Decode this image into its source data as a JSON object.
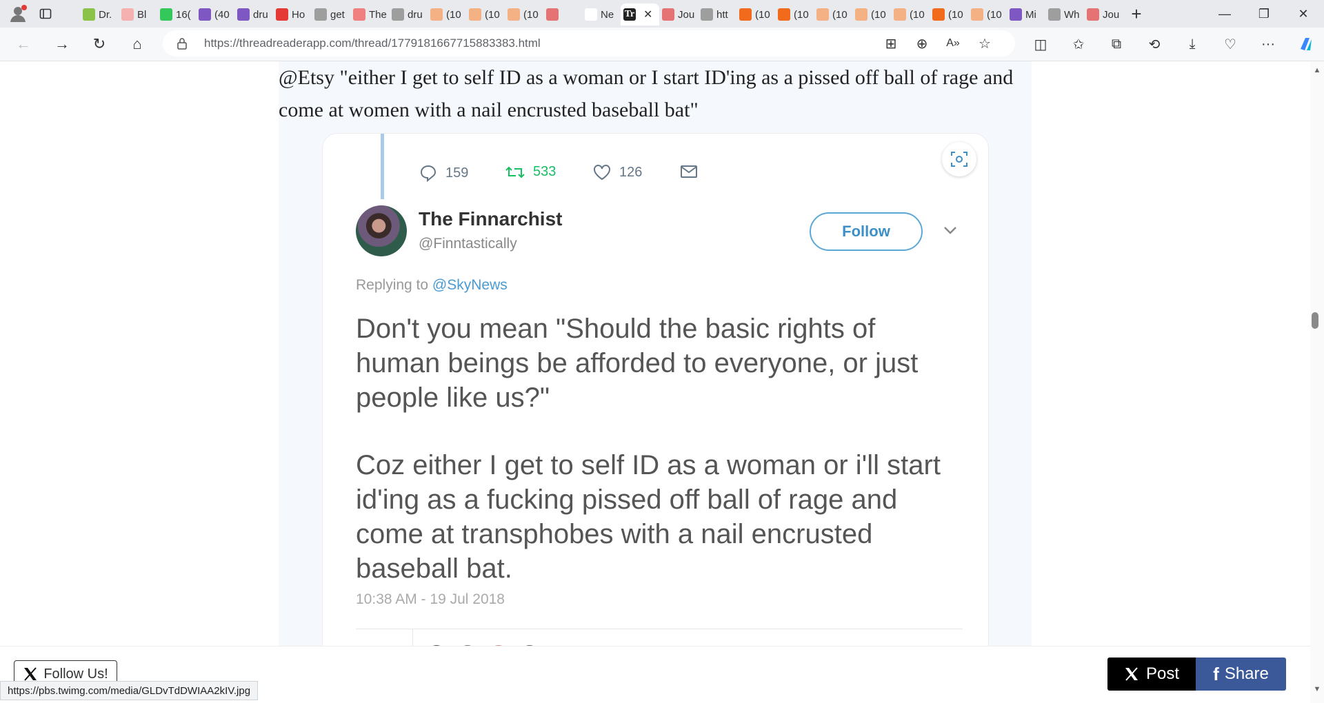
{
  "browser": {
    "tabs": [
      {
        "label": "Dr.",
        "icon": "play-icon",
        "color": "#8bc34a"
      },
      {
        "label": "Bl",
        "icon": "bi-icon",
        "color": "#f5b0b0"
      },
      {
        "label": "16(",
        "icon": "g-icon",
        "color": "#34c759"
      },
      {
        "label": "(40",
        "icon": "yahoo-icon",
        "color": "#7e57c2"
      },
      {
        "label": "dru",
        "icon": "yahoo-icon",
        "color": "#7e57c2"
      },
      {
        "label": "Ho",
        "icon": "pin-icon",
        "color": "#e53935"
      },
      {
        "label": "get",
        "icon": "search-icon",
        "color": "#9e9e9e"
      },
      {
        "label": "The",
        "icon": "ds-icon",
        "color": "#f08080"
      },
      {
        "label": "dru",
        "icon": "file-icon",
        "color": "#9e9e9e"
      },
      {
        "label": "(10",
        "icon": "bookmark-icon",
        "color": "#f4b183"
      },
      {
        "label": "(10",
        "icon": "bookmark-icon",
        "color": "#f4b183"
      },
      {
        "label": "(10",
        "icon": "bookmark-icon",
        "color": "#f4b183"
      },
      {
        "label": "",
        "icon": "r-icon",
        "color": "#e57373"
      },
      {
        "label": "Ne",
        "icon": "",
        "color": "#ffffff"
      }
    ],
    "active_tab": {
      "label": "Tr",
      "close": "✕"
    },
    "tabs_after": [
      {
        "label": "Jou",
        "icon": "youtube-icon",
        "color": "#e57373"
      },
      {
        "label": "htt",
        "icon": "file-icon",
        "color": "#9e9e9e"
      },
      {
        "label": "(10",
        "icon": "bookmark-icon",
        "color": "#f26b1d"
      },
      {
        "label": "(10",
        "icon": "bookmark-icon",
        "color": "#f26b1d"
      },
      {
        "label": "(10",
        "icon": "bookmark-icon",
        "color": "#f4b183"
      },
      {
        "label": "(10",
        "icon": "bookmark-icon",
        "color": "#f4b183"
      },
      {
        "label": "(10",
        "icon": "bookmark-icon",
        "color": "#f4b183"
      },
      {
        "label": "(10",
        "icon": "bookmark-icon",
        "color": "#f26b1d"
      },
      {
        "label": "(10",
        "icon": "bookmark-icon",
        "color": "#f4b183"
      },
      {
        "label": "Mi",
        "icon": "yahoo-icon",
        "color": "#7e57c2"
      },
      {
        "label": "Wh",
        "icon": "file-icon",
        "color": "#9e9e9e"
      },
      {
        "label": "Jou",
        "icon": "youtube-icon",
        "color": "#e57373"
      }
    ],
    "new_tab": "+",
    "url_domain": "https://threadreaderapp.com",
    "url_path": "/thread/1779181667715883383.html"
  },
  "thread": {
    "tweet_text": "@Etsy \"either I get to self ID as a woman or I start ID'ing as a pissed off ball of rage and come at women with a nail encrusted baseball bat\""
  },
  "embedded_tweet": {
    "replies": "159",
    "retweets": "533",
    "likes": "126",
    "name": "The Finnarchist",
    "handle": "@Finntastically",
    "follow_label": "Follow",
    "replying_prefix": "Replying to ",
    "replying_mention": "@SkyNews",
    "body_1": "Don't you mean \"Should the basic rights of human beings be afforded to everyone, or just people like us?\"",
    "body_2": "Coz either I get to self ID as a woman or i'll start id'ing as a fucking pissed off ball of rage and come at transphobes with a nail encrusted baseball bat.",
    "timestamp": "10:38 AM - 19 Jul 2018"
  },
  "footer": {
    "follow_us": "Follow Us!",
    "post_label": "Post",
    "share_label": "Share",
    "status_url": "https://pbs.twimg.com/media/GLDvTdDWIAA2kIV.jpg"
  },
  "colors": {
    "accent": "#1da1f2",
    "retweet_green": "#17bf63",
    "facebook": "#3b5998"
  }
}
